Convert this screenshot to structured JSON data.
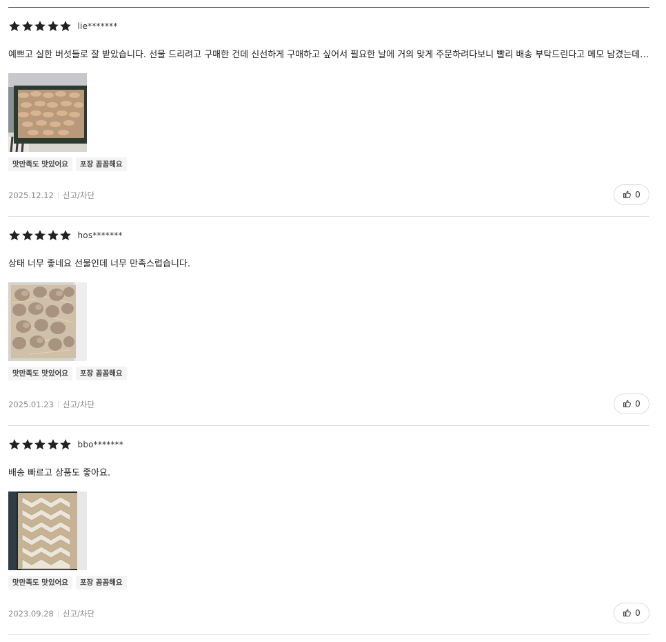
{
  "colors": {
    "star": "#222222",
    "text": "#222222",
    "meta": "#888888",
    "tag_bg": "#f4f4f4",
    "divider": "#dddddd"
  },
  "reviews": [
    {
      "rating": 5,
      "reviewer": "lie*******",
      "text": "예쁘고 실한 버섯들로 잘 받았습니다. 선물 드리려고 구매한 건데 신선하게 구매하고 싶어서 필요한 날에 거의 맞게 주문하려다보니 빨리 배송 부탁드린다고 메모 남겼는데요, 빠르게 보내주셔서 감사합니다.",
      "photo_icon": "mushroom-box-photo",
      "tags": [
        "맛만족도 맛있어요",
        "포장 꼼꼼해요"
      ],
      "date": "2025.12.12",
      "report_label": "신고/차단",
      "likes": "0"
    },
    {
      "rating": 5,
      "reviewer": "hos*******",
      "text": "상태 너무 좋네요 선물인데 너무 만족스럽습니다.",
      "photo_icon": "mushroom-box-photo",
      "tags": [
        "맛만족도 맛있어요",
        "포장 꼼꼼해요"
      ],
      "date": "2025.01.23",
      "report_label": "신고/차단",
      "likes": "0"
    },
    {
      "rating": 5,
      "reviewer": "bbo*******",
      "text": "배송 빠르고 상품도 좋아요.",
      "photo_icon": "mushroom-box-photo",
      "tags": [
        "맛만족도 맛있어요",
        "포장 꼼꼼해요"
      ],
      "date": "2023.09.28",
      "report_label": "신고/차단",
      "likes": "0"
    }
  ]
}
